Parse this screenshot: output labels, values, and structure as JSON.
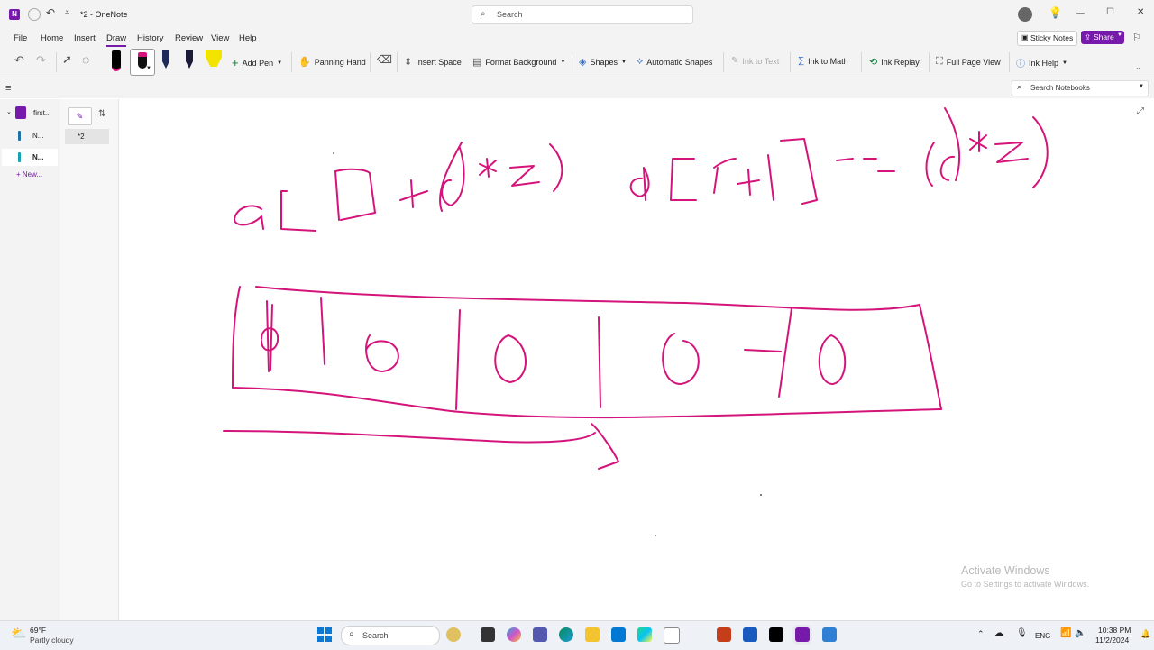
{
  "titlebar": {
    "doc_title": "*2 - OneNote",
    "search_placeholder": "Search",
    "minimize": "—",
    "maximize": "☐",
    "close": "✕"
  },
  "menu": [
    "File",
    "Home",
    "Insert",
    "Draw",
    "History",
    "Review",
    "View",
    "Help"
  ],
  "menu_active": "Draw",
  "menu_right": {
    "sticky_notes": "Sticky Notes",
    "share": "Share"
  },
  "ribbon": {
    "add_pen": "Add Pen",
    "panning_hand": "Panning Hand",
    "insert_space": "Insert Space",
    "format_background": "Format Background",
    "shapes": "Shapes",
    "automatic_shapes": "Automatic Shapes",
    "ink_to_text": "Ink to Text",
    "ink_to_math": "Ink to Math",
    "ink_replay": "Ink Replay",
    "full_page_view": "Full Page View",
    "ink_help": "Ink Help"
  },
  "search_notebooks_placeholder": "Search Notebooks",
  "notebook": {
    "name": "first...",
    "sections": [
      "N...",
      "N..."
    ],
    "new_section": "+ New..."
  },
  "pages": [
    "*2"
  ],
  "activate_windows": {
    "title": "Activate Windows",
    "subtitle": "Go to Settings to activate Windows."
  },
  "taskbar": {
    "weather_temp": "69°F",
    "weather_desc": "Partly cloudy",
    "search": "Search",
    "lang": "ENG",
    "time": "10:38 PM",
    "date": "11/2/2024"
  },
  "colors": {
    "ink": "#d4147a",
    "accent": "#7719aa"
  }
}
